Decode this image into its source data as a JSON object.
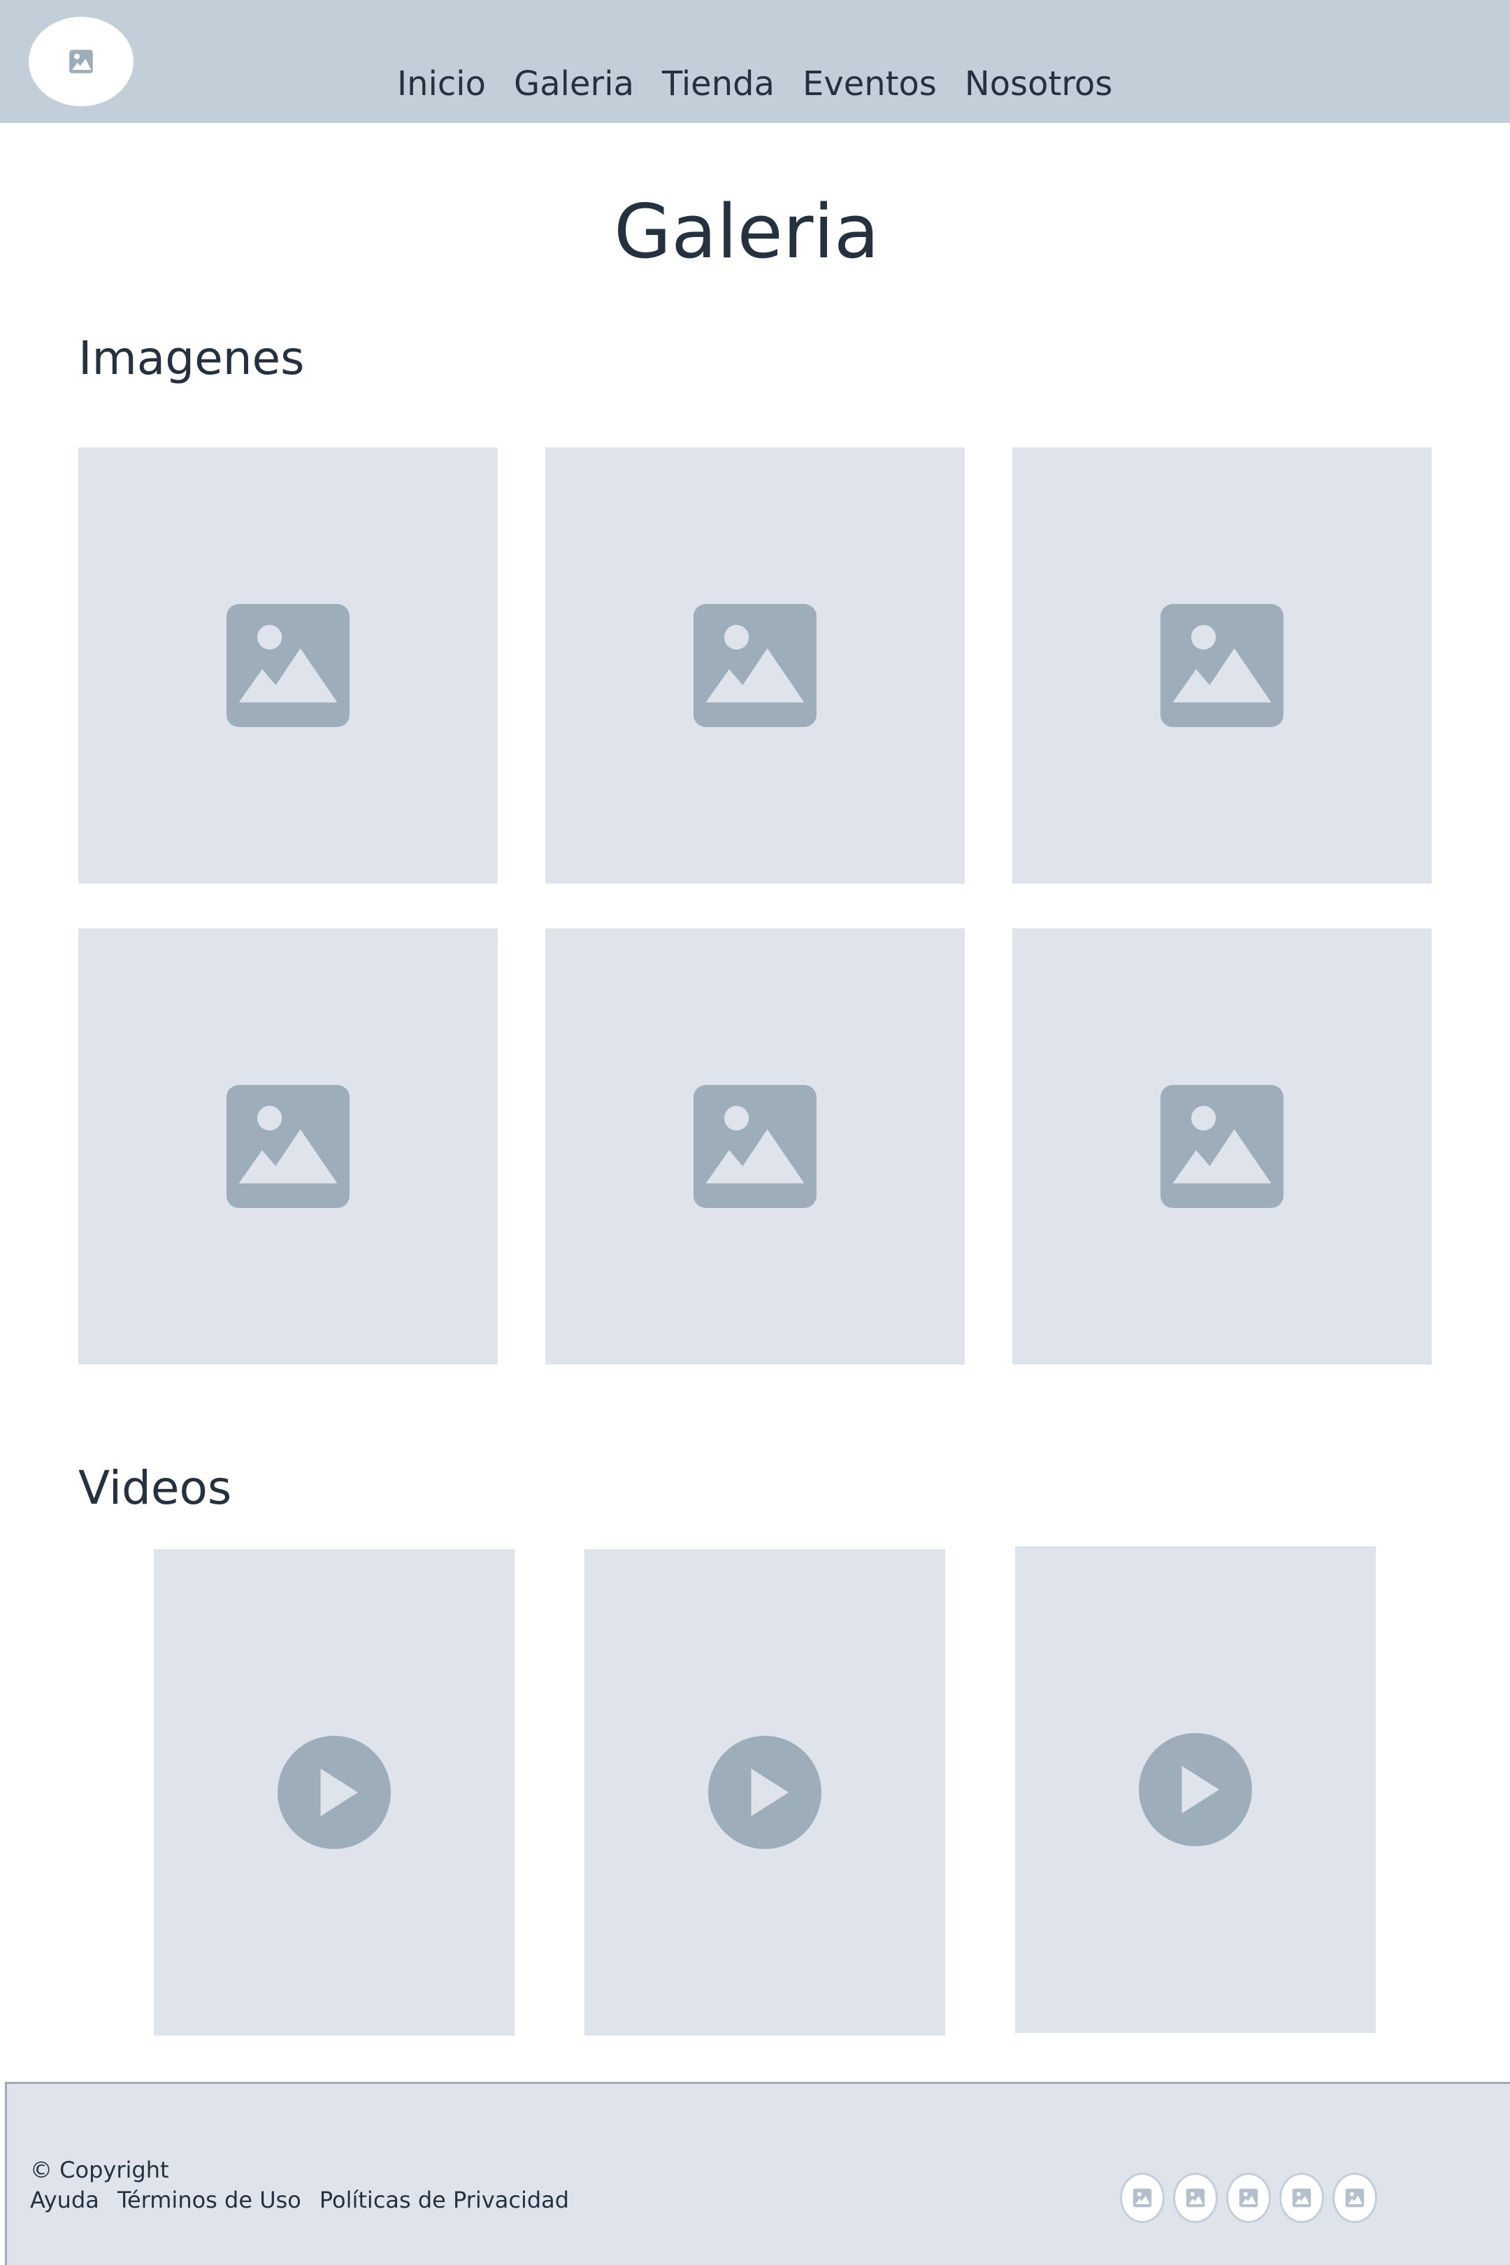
{
  "header": {
    "nav": [
      "Inicio",
      "Galeria",
      "Tienda",
      "Eventos",
      "Nosotros"
    ]
  },
  "main": {
    "title": "Galeria",
    "images_section": {
      "heading": "Imagenes",
      "items": [
        "image-placeholder-icon",
        "image-placeholder-icon",
        "image-placeholder-icon",
        "image-placeholder-icon",
        "image-placeholder-icon",
        "image-placeholder-icon"
      ]
    },
    "videos_section": {
      "heading": "Videos",
      "items": [
        "play-icon",
        "play-icon",
        "play-icon"
      ]
    }
  },
  "footer": {
    "copyright": "© Copyright",
    "links": [
      "Ayuda",
      "Términos de Uso",
      "Políticas de Privacidad"
    ],
    "social_icons": [
      "social-icon",
      "social-icon",
      "social-icon",
      "social-icon",
      "social-icon"
    ]
  },
  "colors": {
    "header_bg": "#c2ced8",
    "tile_bg": "#dfe4ec",
    "icon": "#9eadba",
    "text": "#25313f"
  }
}
